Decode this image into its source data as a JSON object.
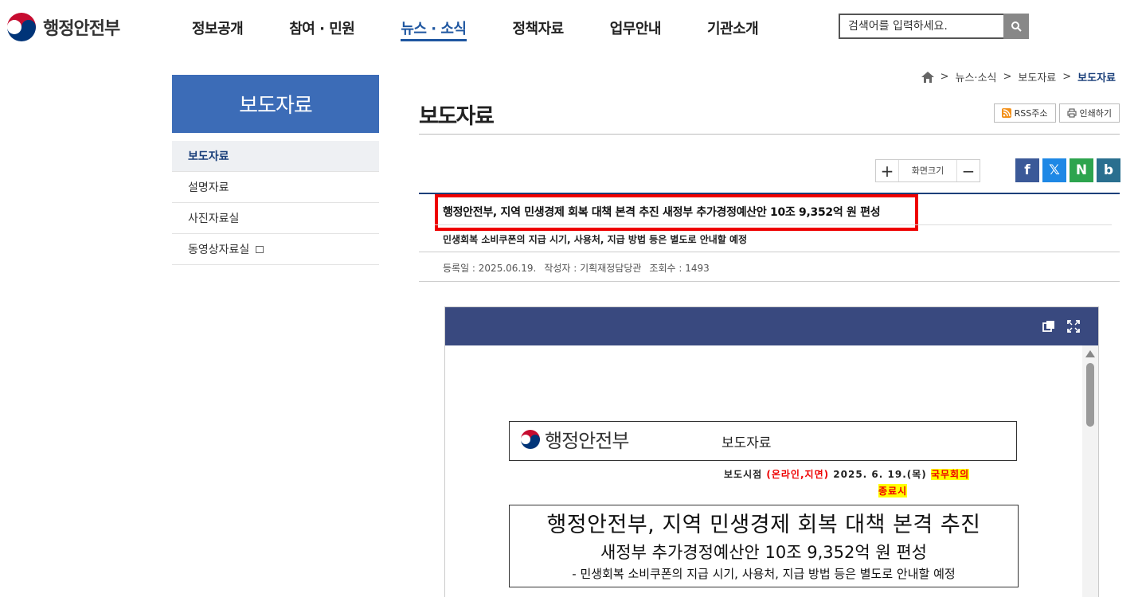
{
  "header": {
    "logo_text": "행정안전부",
    "nav": [
      "정보공개",
      "참여 · 민원",
      "뉴스 · 소식",
      "정책자료",
      "업무안내",
      "기관소개"
    ],
    "search_placeholder": "검색어를 입력하세요."
  },
  "sidebar": {
    "title": "보도자료",
    "items": [
      "보도자료",
      "설명자료",
      "사진자료실",
      "동영상자료실"
    ]
  },
  "breadcrumb": [
    "뉴스·소식",
    "보도자료",
    "보도자료"
  ],
  "page_title": "보도자료",
  "utils": {
    "rss": "RSS주소",
    "print": "인쇄하기"
  },
  "zoom": {
    "plus": "+",
    "label": "화면크기",
    "minus": "−"
  },
  "share": [
    "f",
    "𝕏",
    "N",
    "b"
  ],
  "article": {
    "title": "행정안전부, 지역 민생경제 회복 대책 본격 추진 새정부 추가경정예산안 10조 9,352억 원 편성",
    "subtitle": "민생회복 소비쿠폰의 지급 시기, 사용처, 지급 방법 등은 별도로 안내할 예정",
    "meta": {
      "date": "등록일 : 2025.06.19.",
      "author": "작성자 : 기획재정담당관",
      "views": "조회수 : 1493"
    }
  },
  "doc": {
    "logo_text": "행정안전부",
    "label": "보도자료",
    "release_prefix": "보도시점",
    "release_channel": "(온라인,지면)",
    "release_date": "2025. 6. 19.(목)",
    "release_hl1": "국무회의",
    "release_hl2": "종료시",
    "headline1": "행정안전부, 지역 민생경제 회복 대책 본격 추진",
    "headline2": "새정부 추가경정예산안 10조 9,352억 원 편성",
    "headline3": "- 민생회복 소비쿠폰의 지급 시기, 사용처, 지급 방법 등은 별도로 안내할 예정"
  },
  "colors": {
    "brand_blue": "#1e56a0",
    "sidebar_blue": "#3c6cb7",
    "viewer_bar": "#39497f",
    "highlight_red": "#e00000"
  }
}
